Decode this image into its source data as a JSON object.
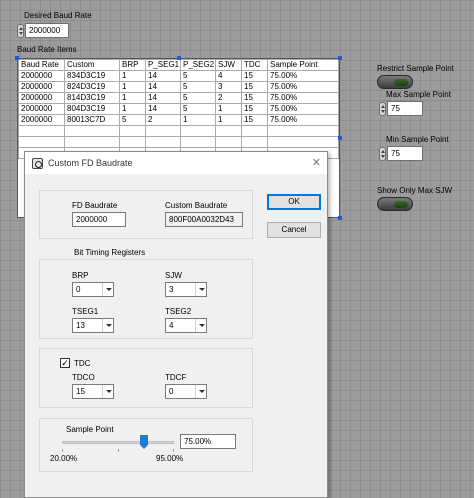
{
  "desired_baud": {
    "label": "Desired Baud Rate",
    "value": "2000000"
  },
  "table": {
    "label": "Baud Rate Items",
    "headers": [
      "Baud Rate",
      "Custom",
      "BRP",
      "P_SEG1",
      "P_SEG2",
      "SJW",
      "TDC",
      "Sample Point"
    ],
    "rows": [
      [
        "2000000",
        "834D3C19",
        "1",
        "14",
        "5",
        "4",
        "15",
        "75.00%"
      ],
      [
        "2000000",
        "824D3C19",
        "1",
        "14",
        "5",
        "3",
        "15",
        "75.00%"
      ],
      [
        "2000000",
        "814D3C19",
        "1",
        "14",
        "5",
        "2",
        "15",
        "75.00%"
      ],
      [
        "2000000",
        "804D3C19",
        "1",
        "14",
        "5",
        "1",
        "15",
        "75.00%"
      ],
      [
        "2000000",
        "80013C7D",
        "5",
        "2",
        "1",
        "1",
        "15",
        "75.00%"
      ]
    ]
  },
  "right_panel": {
    "restrict_label": "Restrict Sample Point",
    "max_label": "Max Sample Point",
    "max_value": "75",
    "min_label": "Min Sample Point",
    "min_value": "75",
    "show_only_label": "Show Only Max SJW"
  },
  "dialog": {
    "title": "Custom FD Baudrate",
    "close_glyph": "✕",
    "fd_baudrate_label": "FD Baudrate",
    "fd_baudrate_value": "2000000",
    "custom_baudrate_label": "Custom Baudrate",
    "custom_baudrate_value": "800F00A0032D43",
    "ok_label": "OK",
    "cancel_label": "Cancel",
    "bit_timing_label": "Bit Timing Registers",
    "brp_label": "BRP",
    "brp_value": "0",
    "sjw_label": "SJW",
    "sjw_value": "3",
    "tseg1_label": "TSEG1",
    "tseg1_value": "13",
    "tseg2_label": "TSEG2",
    "tseg2_value": "4",
    "tdc_label": "TDC",
    "tdc_checked": true,
    "check_glyph": "✓",
    "tdco_label": "TDCO",
    "tdco_value": "15",
    "tdcf_label": "TDCF",
    "tdcf_value": "0",
    "sample_point_label": "Sample Point",
    "sample_point_value": "75.00%",
    "slider_min": "20.00%",
    "slider_max": "95.00%"
  },
  "colors": {
    "accent": "#1e7bd6",
    "selection_handle": "#1c5ad6",
    "led_off": "#1d3c16"
  }
}
